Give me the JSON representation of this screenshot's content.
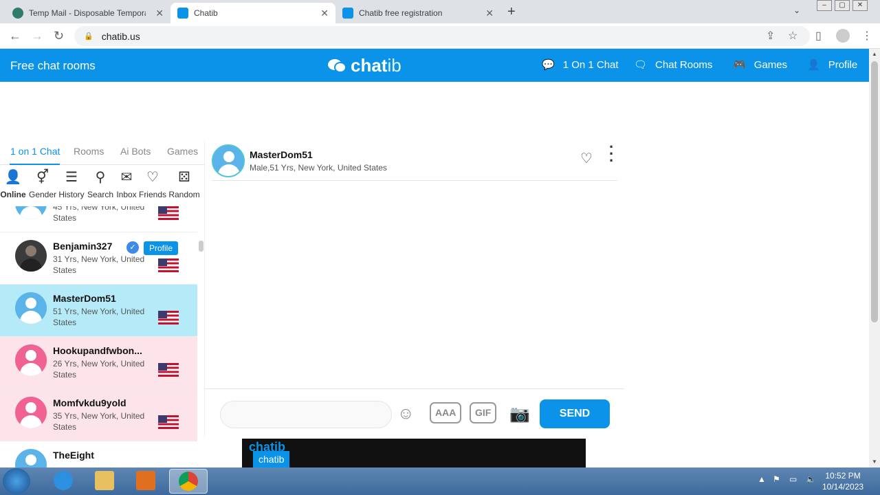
{
  "browser": {
    "tabs": [
      {
        "title": "Temp Mail - Disposable Tempora",
        "active": false
      },
      {
        "title": "Chatib",
        "active": true
      },
      {
        "title": "Chatib free registration",
        "active": false
      }
    ],
    "url": "chatib.us"
  },
  "site": {
    "left_title": "Free chat rooms",
    "logo_chat": "chat",
    "logo_ib": "ib",
    "nav": [
      {
        "label": "1 On 1 Chat",
        "icon": "chat-bubble-icon"
      },
      {
        "label": "Chat Rooms",
        "icon": "chat-rooms-icon"
      },
      {
        "label": "Games",
        "icon": "gamepad-icon"
      },
      {
        "label": "Profile",
        "icon": "user-icon"
      }
    ]
  },
  "left_tabs": [
    "1 on 1 Chat",
    "Rooms",
    "Ai Bots",
    "Games"
  ],
  "icon_row": [
    {
      "label": "Online",
      "icon": "online-user-icon"
    },
    {
      "label": "Gender",
      "icon": "gender-icon"
    },
    {
      "label": "History",
      "icon": "list-icon"
    },
    {
      "label": "Search",
      "icon": "search-icon"
    },
    {
      "label": "Inbox",
      "icon": "mail-icon"
    },
    {
      "label": "Friends",
      "icon": "heart-icon"
    },
    {
      "label": "Random",
      "icon": "dice-icon"
    }
  ],
  "users": [
    {
      "name": "",
      "meta": "45 Yrs, New York, United States",
      "gender": "male"
    },
    {
      "name": "Benjamin327",
      "meta": "31 Yrs, New York, United States",
      "gender": "photo",
      "verified": true,
      "profile_label": "Profile"
    },
    {
      "name": "MasterDom51",
      "meta": "51 Yrs, New York, United States",
      "gender": "male",
      "selected": true
    },
    {
      "name": "Hookupandfwbon...",
      "meta": "26 Yrs, New York, United States",
      "gender": "female"
    },
    {
      "name": "Momfvkdu9yold",
      "meta": "35 Yrs, New York, United States",
      "gender": "female"
    },
    {
      "name": "TheEight",
      "meta": "",
      "gender": "male"
    }
  ],
  "chat": {
    "name": "MasterDom51",
    "meta": "Male,51 Yrs, New York, United States",
    "input_placeholder": "",
    "aaa": "AAA",
    "gif": "GIF",
    "send": "SEND"
  },
  "video": {
    "logo": "chatib",
    "logo2": "chatib"
  },
  "taskbar": {
    "time": "10:52 PM",
    "date": "10/14/2023"
  }
}
